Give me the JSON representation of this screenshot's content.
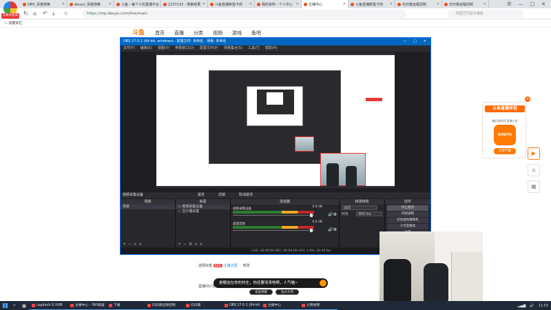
{
  "browser": {
    "logo_label": "云帐号登录",
    "tabs": [
      {
        "label": "OBS_百度搜索",
        "active": false
      },
      {
        "label": "douyu_百度搜索",
        "active": false
      },
      {
        "label": "斗鱼 - 每个人的直播平台",
        "active": false
      },
      {
        "label": "1237133 - 搜索结果",
        "active": false
      },
      {
        "label": "斗鱼直播新盟卡商",
        "active": false
      },
      {
        "label": "我的资料 - 个人中心",
        "active": false
      },
      {
        "label": "主播中心",
        "active": true
      },
      {
        "label": "斗鱼直播新盟卡商",
        "active": false
      },
      {
        "label": "向日葵远程控制",
        "active": false
      },
      {
        "label": "向日葵远程控制",
        "active": false
      }
    ],
    "url_prefix": "https://",
    "url": "mp.douyu.com/live/main",
    "search_placeholder": "阿里巴巴股价暴跌",
    "bookmark": "收藏夹栏"
  },
  "douyu": {
    "logo": "斗鱼",
    "nav": [
      "首页",
      "直播",
      "分类",
      "视频",
      "游戏",
      "鱼吧"
    ],
    "panel": {
      "row1_label": "选择标签",
      "row1_badge": "NEW",
      "row1_link": "主播大厨",
      "row1_action": "修改",
      "row2": "直播间公告 · 晚8:00直播",
      "toast": "是樱这在你的村庄，你还要骂来啥啊，人气喵~",
      "btn_left": "发送弹幕",
      "btn_right": "鱼丸礼物"
    },
    "ad": {
      "title": "斗鱼直播伴侣",
      "sub": "最好用的PC直播工具",
      "icon_text": "DOUYU",
      "button": "立即下载"
    }
  },
  "obs": {
    "title": "OBS 27.0.1 (64-bit, windows) - 配置文件: 未命名 - 场景: 未命名",
    "menu": [
      "文件(F)",
      "编辑(E)",
      "视图(V)",
      "停靠窗口(D)",
      "配置文件(P)",
      "场景集合(S)",
      "工具(T)",
      "帮助(H)"
    ],
    "source_label_row": {
      "source": "视频采集设备",
      "props": "属性",
      "filters": "滤镜",
      "deactivate": "取消激活"
    },
    "docks": {
      "scenes": {
        "header": "场景",
        "items": [
          "场景"
        ]
      },
      "sources": {
        "header": "来源",
        "items": [
          "视频采集设备",
          "显示器采集"
        ]
      },
      "mixer": {
        "header": "混音器",
        "channels": [
          {
            "name": "视频采集设备",
            "level": "0.0 dB"
          },
          {
            "name": "桌面音频",
            "level": "0.0 dB"
          }
        ]
      },
      "transitions": {
        "header": "转场特效",
        "mode": "淡出",
        "duration_label": "时长",
        "duration": "300 ms"
      },
      "controls": {
        "header": "控件",
        "buttons": [
          "停止推流",
          "开始录制",
          "启动虚拟摄像机",
          "工作室模式",
          "设置",
          "退出"
        ]
      }
    },
    "status": "LIVE: 00:00:00   REC: 00:00:00   CPU: 1.6%, 30.00 fps"
  },
  "taskbar": {
    "apps": [
      "Logitech G HUB",
      "主播中心 - 360极速",
      "下载",
      "向日葵远程控制",
      "向日葵",
      "OBS 27.0.1 (64-bit",
      "主播中心",
      "公用视频"
    ],
    "time": "11:53"
  },
  "colors": {
    "brand_orange": "#ff7a00",
    "obs_title_blue": "#0067c0",
    "red_accent": "#e53935"
  }
}
